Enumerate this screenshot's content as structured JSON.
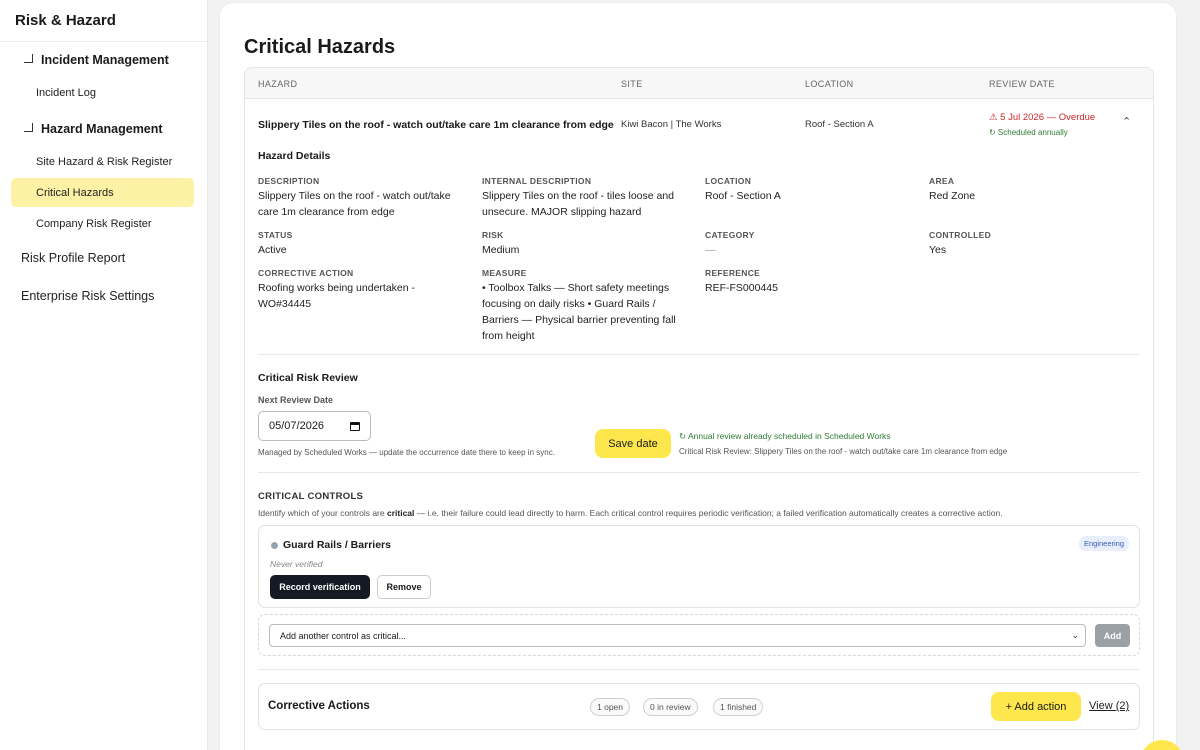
{
  "sidebar": {
    "title": "Risk & Hazard",
    "sections": [
      {
        "label": "Incident Management",
        "items": [
          {
            "label": "Incident Log"
          }
        ]
      },
      {
        "label": "Hazard Management",
        "items": [
          {
            "label": "Site Hazard & Risk Register"
          },
          {
            "label": "Critical Hazards"
          },
          {
            "label": "Company Risk Register"
          }
        ]
      }
    ],
    "top_items": [
      {
        "label": "Risk Profile Report"
      },
      {
        "label": "Enterprise Risk Settings"
      }
    ]
  },
  "page": {
    "title": "Critical Hazards"
  },
  "table": {
    "columns": [
      "HAZARD",
      "SITE",
      "LOCATION",
      "REVIEW DATE"
    ],
    "row": {
      "hazard": "Slippery Tiles on the roof - watch out/take care 1m clearance from edge",
      "site": "Kiwi Bacon | The Works",
      "location": "Roof - Section A",
      "review_date": "⚠ 5 Jul 2026 — Overdue",
      "schedule": "↻ Scheduled annually",
      "chevron": "⌃"
    }
  },
  "details": {
    "title": "Hazard Details",
    "fields": [
      {
        "label": "DESCRIPTION",
        "value": "Slippery Tiles on the roof - watch out/take care 1m clearance from edge"
      },
      {
        "label": "INTERNAL DESCRIPTION",
        "value": "Slippery Tiles on the roof - tiles loose and unsecure. MAJOR slipping hazard"
      },
      {
        "label": "LOCATION",
        "value": "Roof - Section A"
      },
      {
        "label": "AREA",
        "value": "Red Zone"
      },
      {
        "label": "STATUS",
        "value": "Active"
      },
      {
        "label": "RISK",
        "value": "Medium"
      },
      {
        "label": "CATEGORY",
        "value": "—"
      },
      {
        "label": "CONTROLLED",
        "value": "Yes"
      },
      {
        "label": "CORRECTIVE ACTION",
        "value": "Roofing works being undertaken - WO#34445"
      },
      {
        "label": "MEASURE",
        "value": "• Toolbox Talks — Short safety meetings focusing on daily risks • Guard Rails / Barriers — Physical barrier preventing fall from height"
      },
      {
        "label": "REFERENCE",
        "value": "REF-FS000445"
      }
    ]
  },
  "review": {
    "title": "Critical Risk Review",
    "next_label": "Next Review Date",
    "date_value": "05/07/2026",
    "managed_note": "Managed by Scheduled Works — update the occurrence date there to keep in sync.",
    "save_label": "Save date",
    "annual_note": "↻ Annual review already scheduled in Scheduled Works",
    "review_line": "Critical Risk Review: Slippery Tiles on the roof - watch out/take care 1m clearance from edge"
  },
  "controls": {
    "title": "CRITICAL CONTROLS",
    "desc_pre": "Identify which of your controls are ",
    "desc_bold": "critical",
    "desc_post": " — i.e. their failure could lead directly to harm. Each critical control requires periodic verification; a failed verification automatically creates a corrective action.",
    "item": {
      "name": "Guard Rails / Barriers",
      "badge": "Engineering",
      "status": "Never verified",
      "record_label": "Record verification",
      "remove_label": "Remove"
    },
    "add_placeholder": "Add another control as critical...",
    "add_label": "Add"
  },
  "corrective": {
    "title": "Corrective Actions",
    "pills": [
      "1 open",
      "0 in review",
      "1 finished"
    ],
    "add_label": "+ Add action",
    "view_label": "View (2)"
  },
  "colors": {
    "accent": "#fde74c",
    "active_nav": "#fdf1a6",
    "overdue": "#c62828",
    "success": "#2e7d32"
  }
}
